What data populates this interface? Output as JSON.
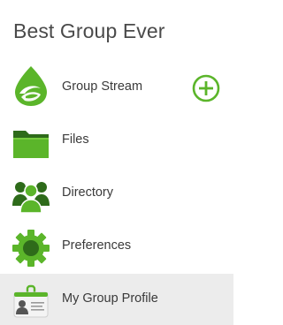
{
  "group": {
    "title": "Best Group Ever"
  },
  "menu": {
    "items": [
      {
        "label": "Group Stream",
        "icon": "group-stream-icon",
        "selected": false
      },
      {
        "label": "Files",
        "icon": "folder-icon",
        "selected": false
      },
      {
        "label": "Directory",
        "icon": "people-icon",
        "selected": false
      },
      {
        "label": "Preferences",
        "icon": "gear-icon",
        "selected": false
      },
      {
        "label": "My Group Profile",
        "icon": "profile-card-icon",
        "selected": true
      }
    ]
  },
  "actions": {
    "add_icon": "plus-circle-icon"
  },
  "colors": {
    "accent_green": "#5bb52a",
    "dark_green": "#2e6b1a",
    "selected_bg": "#ececec",
    "text": "#3a3a3a"
  }
}
